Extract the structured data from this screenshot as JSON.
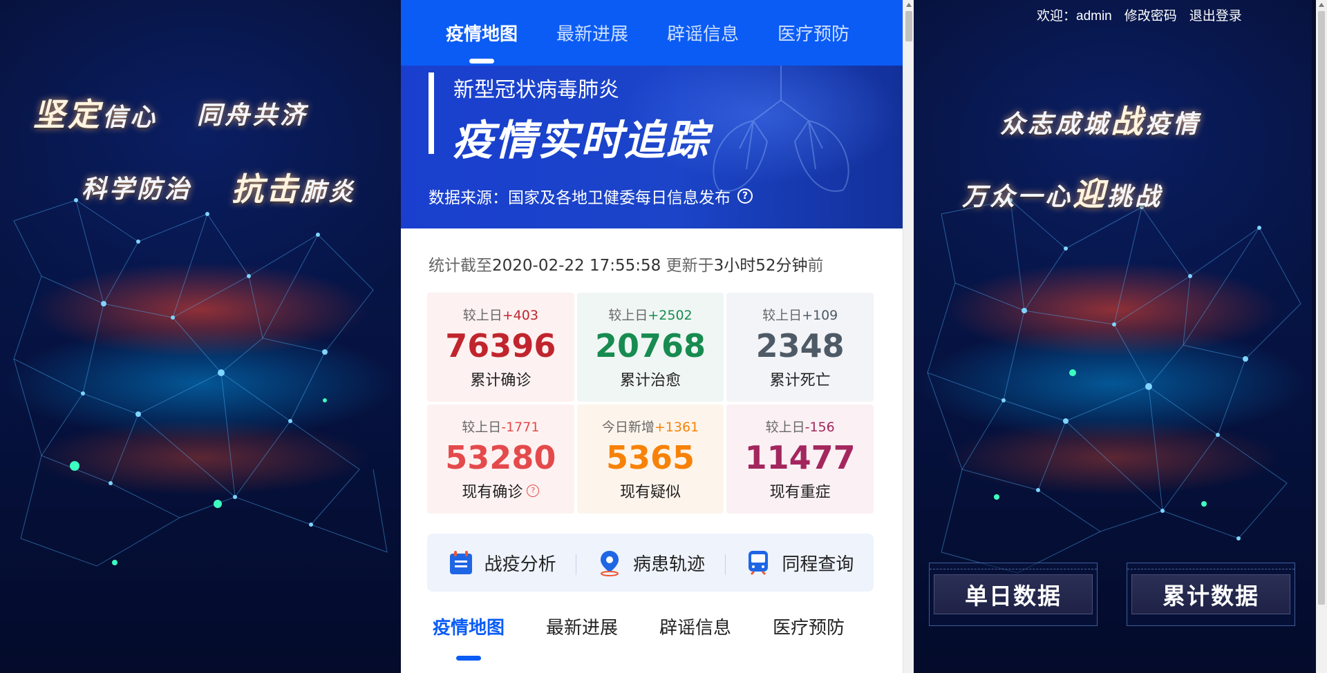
{
  "left_panel": {
    "slogans": [
      {
        "big": "坚定",
        "small": "信心"
      },
      {
        "big": "",
        "small": "同舟共济"
      },
      {
        "big": "",
        "small": "科学防治"
      },
      {
        "big": "抗击",
        "small": "肺炎"
      }
    ]
  },
  "right_panel": {
    "slogans": [
      {
        "pre": "众志成城",
        "big": "战",
        "post": "疫情"
      },
      {
        "pre": "万众一心",
        "big": "迎",
        "post": "挑战"
      }
    ],
    "userbar": {
      "welcome": "欢迎：admin",
      "change_password": "修改密码",
      "logout": "退出登录"
    },
    "buttons": {
      "daily": "单日数据",
      "cumulative": "累计数据"
    }
  },
  "top_tabs": [
    "疫情地图",
    "最新进展",
    "辟谣信息",
    "医疗预防"
  ],
  "banner": {
    "subtitle": "新型冠状病毒肺炎",
    "title": "疫情实时追踪",
    "source": "数据来源：国家及各地卫健委每日信息发布"
  },
  "stat_time": {
    "prefix": "统计截至",
    "datetime": "2020-02-22 17:55:58",
    "middle": "更新于",
    "ago": "3小时52分钟",
    "suffix": "前"
  },
  "stats": [
    {
      "delta_label": "较上日",
      "delta": "+403",
      "value": "76396",
      "label": "累计确诊"
    },
    {
      "delta_label": "较上日",
      "delta": "+2502",
      "value": "20768",
      "label": "累计治愈"
    },
    {
      "delta_label": "较上日",
      "delta": "+109",
      "value": "2348",
      "label": "累计死亡"
    },
    {
      "delta_label": "较上日",
      "delta": "-1771",
      "value": "53280",
      "label": "现有确诊"
    },
    {
      "delta_label": "今日新增",
      "delta": "+1361",
      "value": "5365",
      "label": "现有疑似"
    },
    {
      "delta_label": "较上日",
      "delta": "-156",
      "value": "11477",
      "label": "现有重症"
    }
  ],
  "quick_links": {
    "analysis": "战疫分析",
    "track": "病患轨迹",
    "trip": "同程查询"
  },
  "bottom_tabs": [
    "疫情地图",
    "最新进展",
    "辟谣信息",
    "医疗预防"
  ],
  "colors": {
    "brand_blue": "#0b5cf5",
    "confirmed": "#c0252d",
    "cured": "#178b50",
    "death": "#4e5a65",
    "current_confirmed": "#e44a4c",
    "suspected": "#f78207",
    "severe": "#a3265e"
  }
}
